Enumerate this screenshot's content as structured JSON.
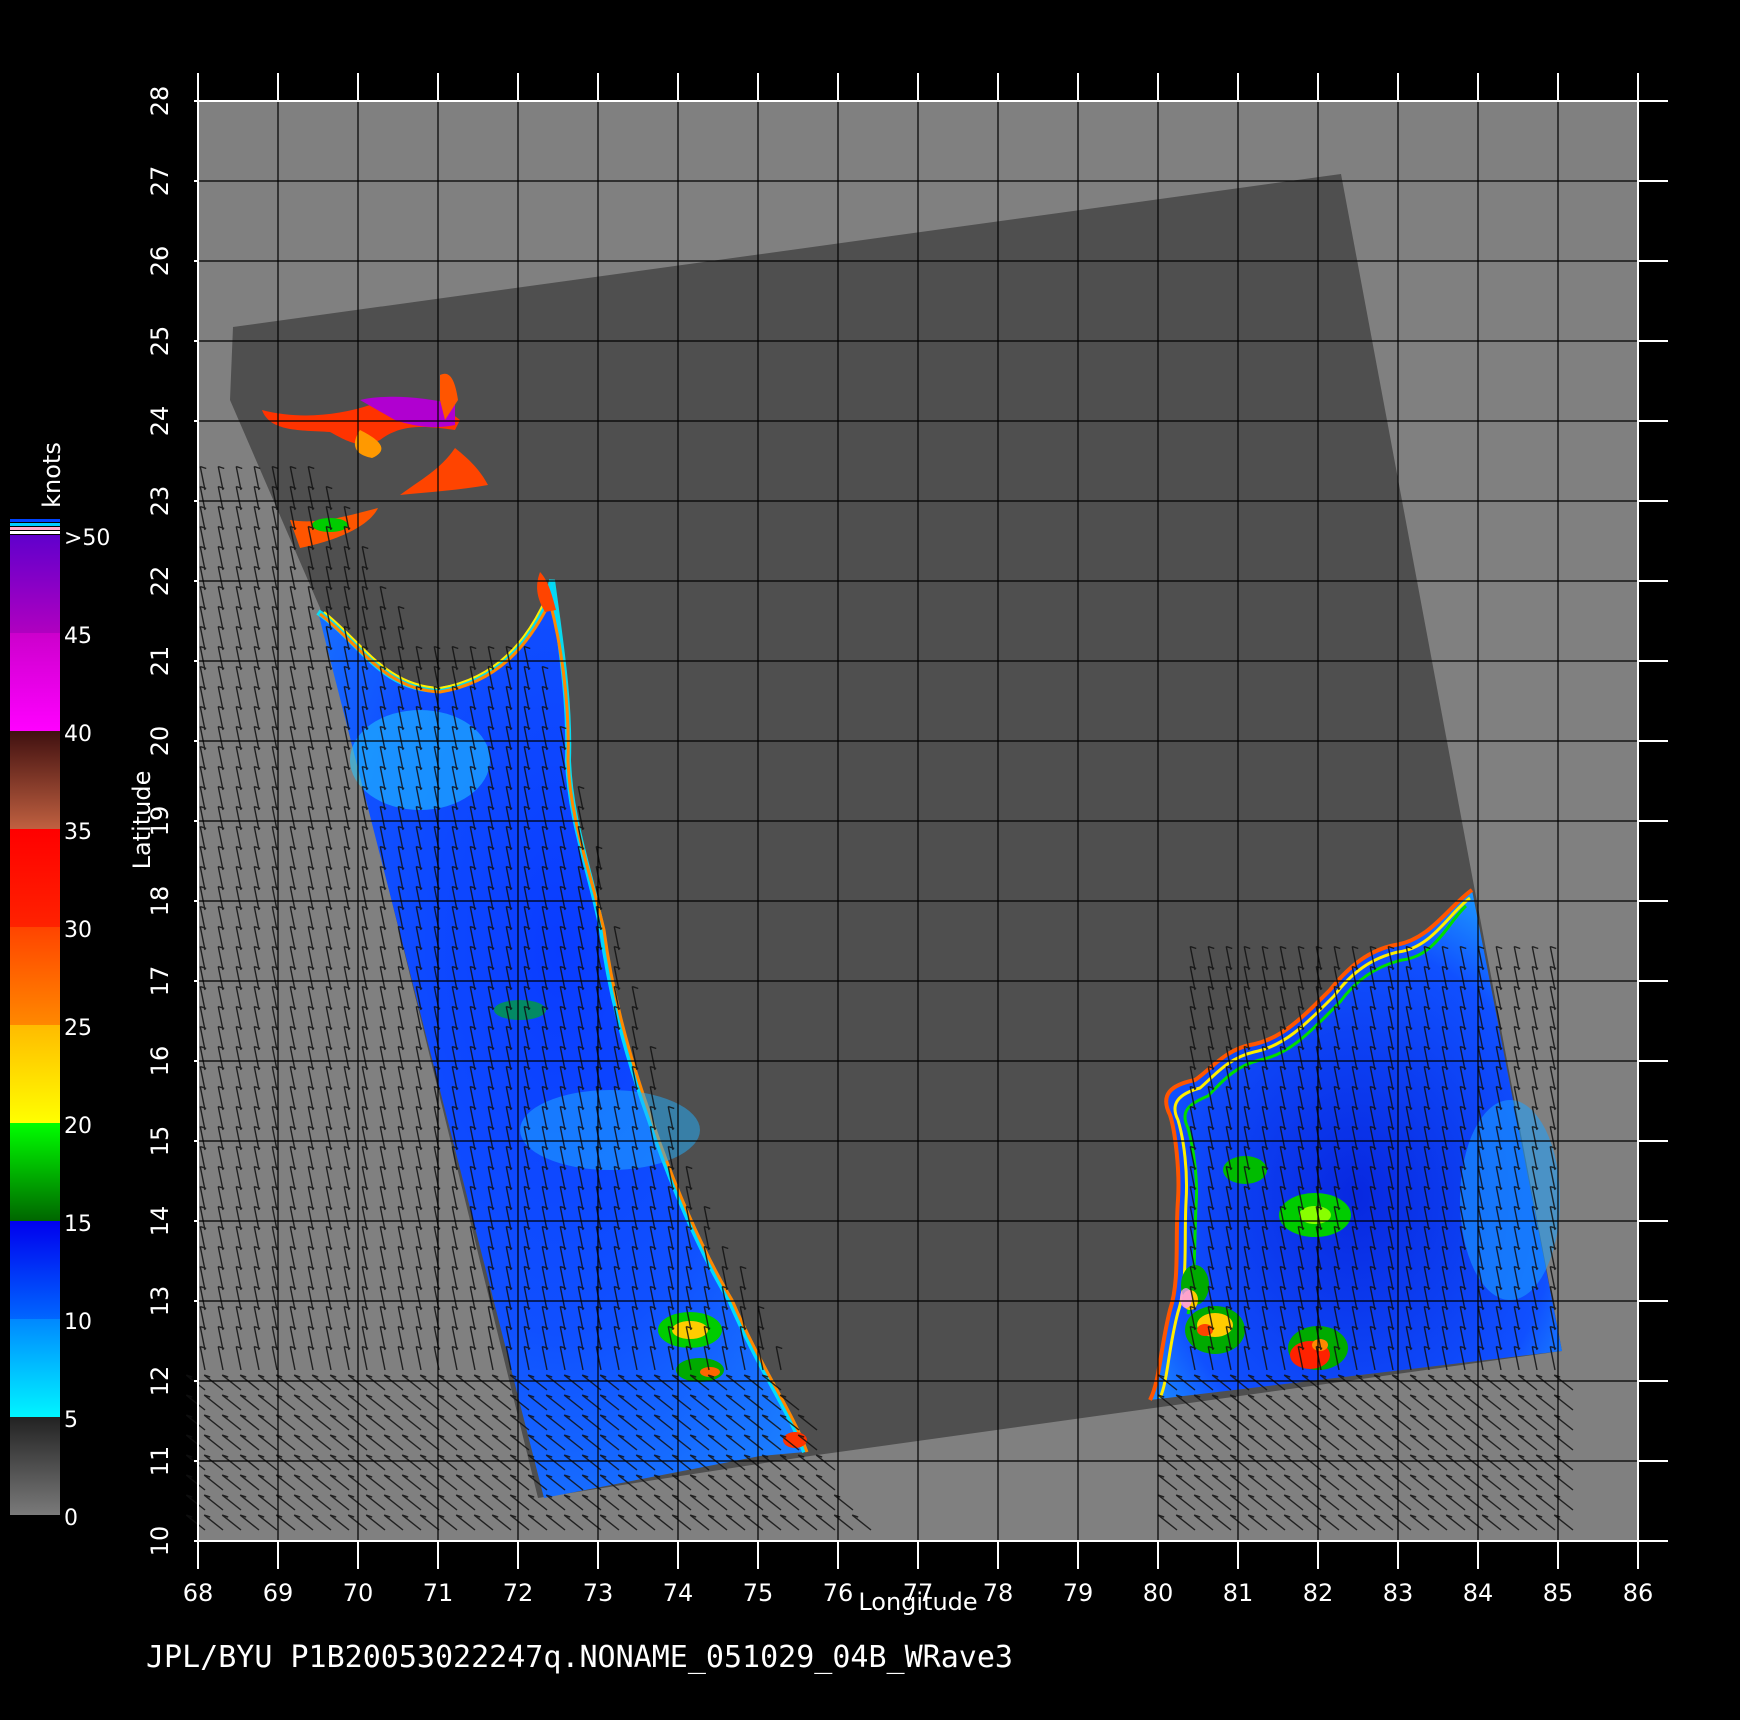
{
  "chart_data": {
    "type": "map",
    "title": "",
    "xlabel": "Longitude",
    "ylabel": "Latitude",
    "xlim": [
      68,
      86
    ],
    "ylim": [
      10,
      28
    ],
    "x_ticks": [
      "68",
      "69",
      "70",
      "71",
      "72",
      "73",
      "74",
      "75",
      "76",
      "77",
      "78",
      "79",
      "80",
      "81",
      "82",
      "83",
      "84",
      "85",
      "86"
    ],
    "y_ticks": [
      "10",
      "11",
      "12",
      "13",
      "14",
      "15",
      "16",
      "17",
      "18",
      "19",
      "20",
      "21",
      "22",
      "23",
      "24",
      "25",
      "26",
      "27",
      "28"
    ],
    "grid": true,
    "colorbar": {
      "unit_label": "knots",
      "labels": [
        "0",
        "5",
        "10",
        "15",
        "20",
        "25",
        "30",
        "35",
        "40",
        "45",
        ">50"
      ],
      "segments": [
        {
          "from": 0,
          "to": 5,
          "colors": [
            "#7a7a7a",
            "#222222"
          ]
        },
        {
          "from": 5,
          "to": 10,
          "colors": [
            "#00f5ff",
            "#0088ff"
          ]
        },
        {
          "from": 10,
          "to": 15,
          "colors": [
            "#0066ff",
            "#0000ee"
          ]
        },
        {
          "from": 15,
          "to": 20,
          "colors": [
            "#006600",
            "#00ff00"
          ]
        },
        {
          "from": 20,
          "to": 25,
          "colors": [
            "#ffff00",
            "#ffbb00"
          ]
        },
        {
          "from": 25,
          "to": 30,
          "colors": [
            "#ff8800",
            "#ff4400"
          ]
        },
        {
          "from": 30,
          "to": 35,
          "colors": [
            "#ff2200",
            "#ff0000"
          ]
        },
        {
          "from": 35,
          "to": 40,
          "colors": [
            "#c06040",
            "#401010"
          ]
        },
        {
          "from": 40,
          "to": 45,
          "colors": [
            "#ff00ff",
            "#cc00cc"
          ]
        },
        {
          "from": 45,
          "to": 50,
          "colors": [
            "#b000c0",
            "#6000cc"
          ]
        }
      ]
    },
    "swath_corners_lonlat": [
      [
        68.4,
        25.2
      ],
      [
        82.3,
        27.1
      ],
      [
        84.0,
        18.2
      ],
      [
        85.1,
        12.4
      ],
      [
        75.7,
        11.1
      ],
      [
        68.4,
        25.2
      ]
    ],
    "land_value_color": "#4f4f4f",
    "background_color": "#808080"
  },
  "caption": "JPL/BYU  P1B20053022247q.NONAME_051029_04B_WRave3"
}
